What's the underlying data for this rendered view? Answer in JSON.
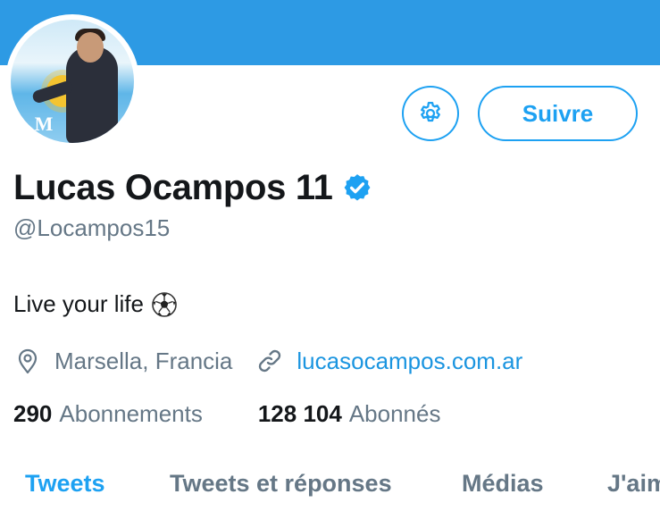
{
  "profile": {
    "name": "Lucas Ocampos 11",
    "handle": "@Locampos15",
    "bio": "Live your life",
    "location": "Marsella, Francia",
    "website": "lucasocampos.com.ar",
    "verified": true
  },
  "actions": {
    "follow_label": "Suivre"
  },
  "stats": {
    "following_count": "290",
    "following_label": "Abonnements",
    "followers_count": "128 104",
    "followers_label": "Abonnés"
  },
  "tabs": [
    {
      "label": "Tweets",
      "active": true
    },
    {
      "label": "Tweets et réponses",
      "active": false
    },
    {
      "label": "Médias",
      "active": false
    },
    {
      "label": "J'aime",
      "active": false
    }
  ],
  "icons": {
    "settings": "gear-icon",
    "verified": "verified-badge-icon",
    "emoji": "soccer-ball-icon",
    "location": "map-pin-icon",
    "link": "link-icon"
  },
  "colors": {
    "banner": "#2d9ae4",
    "accent": "#1da1f2",
    "link": "#1b95e0",
    "secondary_text": "#657786",
    "primary_text": "#14171a"
  }
}
